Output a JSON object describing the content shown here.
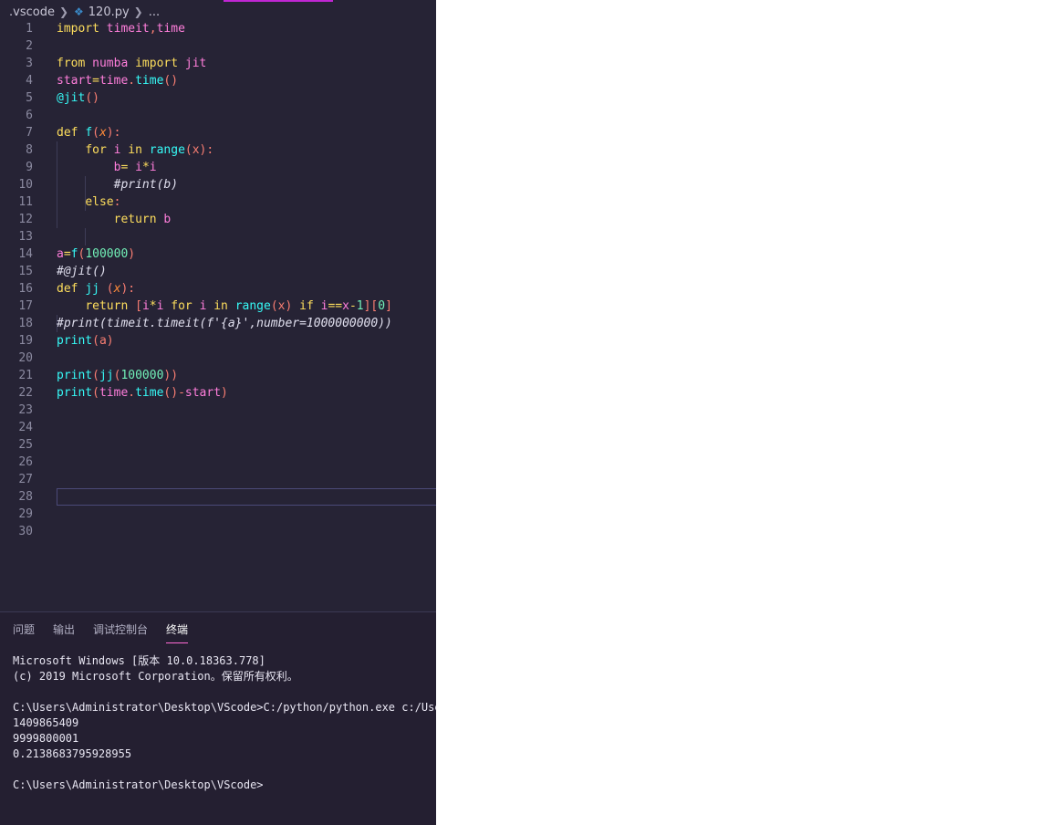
{
  "breadcrumb": {
    "folder": ".vscode",
    "file_icon": "python-icon",
    "file": "120.py",
    "more": "..."
  },
  "editor": {
    "current_line": 28,
    "lines": [
      {
        "n": "1",
        "tokens": [
          [
            "import ",
            "kw"
          ],
          [
            "timeit",
            "mod"
          ],
          [
            ",",
            "pun"
          ],
          [
            "time",
            "mod"
          ]
        ]
      },
      {
        "n": "2",
        "tokens": []
      },
      {
        "n": "3",
        "tokens": [
          [
            "from ",
            "kw"
          ],
          [
            "numba ",
            "mod"
          ],
          [
            "import ",
            "kw"
          ],
          [
            "jit",
            "mod"
          ]
        ]
      },
      {
        "n": "4",
        "tokens": [
          [
            "start",
            "id"
          ],
          [
            "=",
            "op"
          ],
          [
            "time",
            "mod"
          ],
          [
            ".",
            "pun"
          ],
          [
            "time",
            "fn"
          ],
          [
            "()",
            "pun"
          ]
        ]
      },
      {
        "n": "5",
        "tokens": [
          [
            "@jit",
            "fn"
          ],
          [
            "()",
            "pun"
          ]
        ]
      },
      {
        "n": "6",
        "tokens": []
      },
      {
        "n": "7",
        "tokens": [
          [
            "def ",
            "kw"
          ],
          [
            "f",
            "fn"
          ],
          [
            "(",
            "pun"
          ],
          [
            "x",
            "par"
          ],
          [
            "):",
            "pun"
          ]
        ]
      },
      {
        "n": "8",
        "tokens": [
          [
            "    ",
            "plain"
          ],
          [
            "for ",
            "kw"
          ],
          [
            "i ",
            "id"
          ],
          [
            "in ",
            "kw"
          ],
          [
            "range",
            "fn"
          ],
          [
            "(x):",
            "pun"
          ]
        ]
      },
      {
        "n": "9",
        "tokens": [
          [
            "        ",
            "plain"
          ],
          [
            "b",
            "id"
          ],
          [
            "= ",
            "op"
          ],
          [
            "i",
            "id"
          ],
          [
            "*",
            "op"
          ],
          [
            "i",
            "id"
          ]
        ]
      },
      {
        "n": "10",
        "tokens": [
          [
            "        ",
            "plain"
          ],
          [
            "#print(b)",
            "cm"
          ]
        ]
      },
      {
        "n": "11",
        "tokens": [
          [
            "    ",
            "plain"
          ],
          [
            "else",
            "kw"
          ],
          [
            ":",
            "pun"
          ]
        ]
      },
      {
        "n": "12",
        "tokens": [
          [
            "        ",
            "plain"
          ],
          [
            "return ",
            "kw"
          ],
          [
            "b",
            "id"
          ]
        ]
      },
      {
        "n": "13",
        "tokens": []
      },
      {
        "n": "14",
        "tokens": [
          [
            "a",
            "id"
          ],
          [
            "=",
            "op"
          ],
          [
            "f",
            "fn"
          ],
          [
            "(",
            "pun"
          ],
          [
            "100000",
            "num"
          ],
          [
            ")",
            "pun"
          ]
        ]
      },
      {
        "n": "15",
        "tokens": [
          [
            "#@jit()",
            "cm"
          ]
        ]
      },
      {
        "n": "16",
        "tokens": [
          [
            "def ",
            "kw"
          ],
          [
            "jj ",
            "fn"
          ],
          [
            "(",
            "pun"
          ],
          [
            "x",
            "par"
          ],
          [
            "):",
            "pun"
          ]
        ]
      },
      {
        "n": "17",
        "tokens": [
          [
            "    ",
            "plain"
          ],
          [
            "return ",
            "kw"
          ],
          [
            "[",
            "pun"
          ],
          [
            "i",
            "id"
          ],
          [
            "*",
            "op"
          ],
          [
            "i ",
            "id"
          ],
          [
            "for ",
            "kw"
          ],
          [
            "i ",
            "id"
          ],
          [
            "in ",
            "kw"
          ],
          [
            "range",
            "fn"
          ],
          [
            "(x) ",
            "pun"
          ],
          [
            "if ",
            "kw"
          ],
          [
            "i",
            "id"
          ],
          [
            "==",
            "op"
          ],
          [
            "x",
            "id"
          ],
          [
            "-",
            "op"
          ],
          [
            "1",
            "num"
          ],
          [
            "][",
            "pun"
          ],
          [
            "0",
            "num"
          ],
          [
            "]",
            "pun"
          ]
        ]
      },
      {
        "n": "18",
        "tokens": [
          [
            "#print(timeit.timeit(f'{a}',number=1000000000))",
            "cm"
          ]
        ]
      },
      {
        "n": "19",
        "tokens": [
          [
            "print",
            "fn"
          ],
          [
            "(a)",
            "pun"
          ]
        ]
      },
      {
        "n": "20",
        "tokens": []
      },
      {
        "n": "21",
        "tokens": [
          [
            "print",
            "fn"
          ],
          [
            "(",
            "pun"
          ],
          [
            "jj",
            "fn"
          ],
          [
            "(",
            "pun"
          ],
          [
            "100000",
            "num"
          ],
          [
            "))",
            "pun"
          ]
        ]
      },
      {
        "n": "22",
        "tokens": [
          [
            "print",
            "fn"
          ],
          [
            "(",
            "pun"
          ],
          [
            "time",
            "mod"
          ],
          [
            ".",
            "pun"
          ],
          [
            "time",
            "fn"
          ],
          [
            "()-",
            "pun"
          ],
          [
            "start",
            "id"
          ],
          [
            ")",
            "pun"
          ]
        ]
      },
      {
        "n": "23",
        "tokens": []
      },
      {
        "n": "24",
        "tokens": []
      },
      {
        "n": "25",
        "tokens": []
      },
      {
        "n": "26",
        "tokens": []
      },
      {
        "n": "27",
        "tokens": []
      },
      {
        "n": "28",
        "tokens": []
      },
      {
        "n": "29",
        "tokens": []
      },
      {
        "n": "30",
        "tokens": []
      }
    ]
  },
  "panel": {
    "tabs": [
      {
        "label": "问题",
        "active": false
      },
      {
        "label": "输出",
        "active": false
      },
      {
        "label": "调试控制台",
        "active": false
      },
      {
        "label": "终端",
        "active": true
      }
    ]
  },
  "terminal": {
    "lines": [
      "Microsoft Windows [版本 10.0.18363.778]",
      "(c) 2019 Microsoft Corporation。保留所有权利。",
      "",
      "C:\\Users\\Administrator\\Desktop\\VScode>C:/python/python.exe c:/Users/",
      "1409865409",
      "9999800001",
      "0.2138683795928955",
      "",
      "C:\\Users\\Administrator\\Desktop\\VScode>"
    ]
  },
  "colors": {
    "editor_bg": "#262335",
    "keyword": "#fede5d",
    "function": "#36f9f6",
    "identifier": "#ff7edb",
    "number": "#72f1b8",
    "punctuation": "#f97e72",
    "active_tab_underline": "#ff6ad5"
  }
}
